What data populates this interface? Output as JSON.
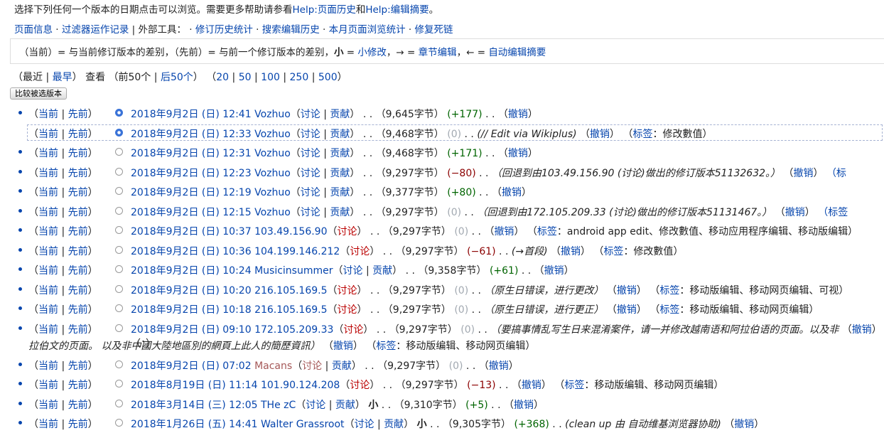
{
  "intro": {
    "text": "选择下列任何一个版本的日期点击可以浏览。需要更多帮助请参看",
    "link1": "Help:页面历史",
    "and": "和",
    "link2": "Help:编辑摘要",
    "end": "。"
  },
  "tools": {
    "page_info": "页面信息",
    "sep1": " · ",
    "filter_log": "过滤器运作记录",
    "ext_label": " | 外部工具： · ",
    "rev_stats": "修订历史统计",
    "search_hist": "搜索编辑历史",
    "month_views": "本月页面浏览统计",
    "fix_links": "修复死链"
  },
  "legend": {
    "cur": "（当前）= 与当前修订版本的差别，（先前）= 与前一个修订版本的差别，",
    "minor_sym": "小",
    "eq1": " = ",
    "minor": "小修改",
    "arrow": "，→ = ",
    "section": "章节编辑",
    "back": "，← = ",
    "auto": "自动编辑摘要"
  },
  "nav": {
    "open": "（",
    "latest": "最近",
    "bar": " | ",
    "earliest": "最早",
    "close_view": "）  查看  （前50个 | ",
    "next50": "后50个",
    "close2": "）  （",
    "n20": "20",
    "n50": "50",
    "n100": "100",
    "n250": "250",
    "n500": "500",
    "close3": "）"
  },
  "compare_button": "比较被选版本",
  "labels": {
    "cur": "当前",
    "prev": "先前",
    "talk": "讨论",
    "contribs": "贡献",
    "undo": "撤销",
    "tags": "标签",
    "minor": "小"
  },
  "rows": [
    {
      "date": "2018年9月2日 (日) 12:41",
      "user": "Vozhuo",
      "bytes": "（9,645字节）",
      "diff": "(+177)",
      "diffClass": "pos",
      "summary": "",
      "tags": "",
      "radioOn": true,
      "selected": false
    },
    {
      "date": "2018年9月2日 (日) 12:33",
      "user": "Vozhuo",
      "bytes": "（9,468字节）",
      "diff": "(0)",
      "diffClass": "zero",
      "summary": "(// Edit via Wikiplus)",
      "tags": "修改數值",
      "radioOn": true,
      "selected": true
    },
    {
      "date": "2018年9月2日 (日) 12:31",
      "user": "Vozhuo",
      "bytes": "（9,468字节）",
      "diff": "(+171)",
      "diffClass": "pos",
      "summary": "",
      "tags": "",
      "radioOn": false,
      "selected": false
    },
    {
      "date": "2018年9月2日 (日) 12:23",
      "user": "Vozhuo",
      "bytes": "（9,297字节）",
      "diff": "(−80)",
      "diffClass": "neg",
      "summary": "（回退到由103.49.156.90 (讨论)做出的修订版本51132632。）",
      "tags": "",
      "tagsOverflow": "（标",
      "radioOn": false,
      "selected": false
    },
    {
      "date": "2018年9月2日 (日) 12:19",
      "user": "Vozhuo",
      "bytes": "（9,377字节）",
      "diff": "(+80)",
      "diffClass": "pos",
      "summary": "",
      "tags": "",
      "radioOn": false,
      "selected": false
    },
    {
      "date": "2018年9月2日 (日) 12:15",
      "user": "Vozhuo",
      "bytes": "（9,297字节）",
      "diff": "(0)",
      "diffClass": "zero",
      "summary": "（回退到由172.105.209.33 (讨论)做出的修订版本51131467。）",
      "tags": "",
      "tagsOverflow": "（标签",
      "radioOn": false,
      "selected": false
    },
    {
      "date": "2018年9月2日 (日) 10:37",
      "user": "103.49.156.90",
      "anon": true,
      "bytes": "（9,297字节）",
      "diff": "(0)",
      "diffClass": "zero",
      "summary": "",
      "tags": "android app edit、修改數值、移动应用程序编辑、移动版编辑",
      "radioOn": false,
      "selected": false
    },
    {
      "date": "2018年9月2日 (日) 10:36",
      "user": "104.199.146.212",
      "anon": true,
      "bytes": "（9,297字节）",
      "diff": "(−61)",
      "diffClass": "neg",
      "summary": "(→首段)",
      "tags": "修改數值",
      "radioOn": false,
      "selected": false
    },
    {
      "date": "2018年9月2日 (日) 10:24",
      "user": "Musicinsummer",
      "bytes": "（9,358字节）",
      "diff": "(+61)",
      "diffClass": "pos",
      "summary": "",
      "tags": "",
      "radioOn": false,
      "selected": false
    },
    {
      "date": "2018年9月2日 (日) 10:20",
      "user": "216.105.169.5",
      "anon": true,
      "bytes": "（9,297字节）",
      "diff": "(0)",
      "diffClass": "zero",
      "summary": "（原生日错误，进行更改）",
      "tags": "移动版编辑、移动网页编辑、可视",
      "radioOn": false,
      "selected": false
    },
    {
      "date": "2018年9月2日 (日) 10:18",
      "user": "216.105.169.5",
      "anon": true,
      "bytes": "（9,297字节）",
      "diff": "(0)",
      "diffClass": "zero",
      "summary": "（原生日错误，进行更正）",
      "tags": "移动版编辑、移动网页编辑",
      "radioOn": false,
      "selected": false
    },
    {
      "date": "2018年9月2日 (日) 09:10",
      "user": "172.105.209.33",
      "anon": true,
      "bytes": "（9,297字节）",
      "diff": "(0)",
      "diffClass": "zero",
      "summary": "（要搞事情乱写生日来混淆案件，请一并修改越南语和阿拉伯语的页面。以及非",
      "summary2": "拉伯文的页面。 以及非中國大陸地區別的網頁上此人的簡歷資訊）",
      "tags": "移动版编辑、移动网页编辑",
      "radioOn": false,
      "selected": false,
      "tall": true
    },
    {
      "date": "2018年9月2日 (日) 07:02",
      "user": "Macans",
      "newUser": true,
      "bytes": "（9,297字节）",
      "diff": "(0)",
      "diffClass": "zero",
      "summary": "",
      "tags": "",
      "radioOn": false,
      "selected": false
    },
    {
      "date": "2018年8月19日 (日) 11:14",
      "user": "101.90.124.208",
      "anon": true,
      "bytes": "（9,297字节）",
      "diff": "(−13)",
      "diffClass": "neg",
      "summary": "",
      "tags": "移动版编辑、移动网页编辑",
      "radioOn": false,
      "selected": false
    },
    {
      "date": "2018年3月14日 (三) 12:05",
      "user": "THe zC",
      "bytes": "（9,310字节）",
      "diff": "(+5)",
      "diffClass": "pos",
      "summary": "",
      "tags": "",
      "minor": true,
      "radioOn": false,
      "selected": false
    },
    {
      "date": "2018年1月26日 (五) 14:41",
      "user": "Walter Grassroot",
      "bytes": "（9,305字节）",
      "diff": "(+368)",
      "diffClass": "pos",
      "summary": "(clean up 由 自动维基浏览器协助)",
      "tags": "",
      "minor": true,
      "radioOn": false,
      "selected": false
    }
  ]
}
